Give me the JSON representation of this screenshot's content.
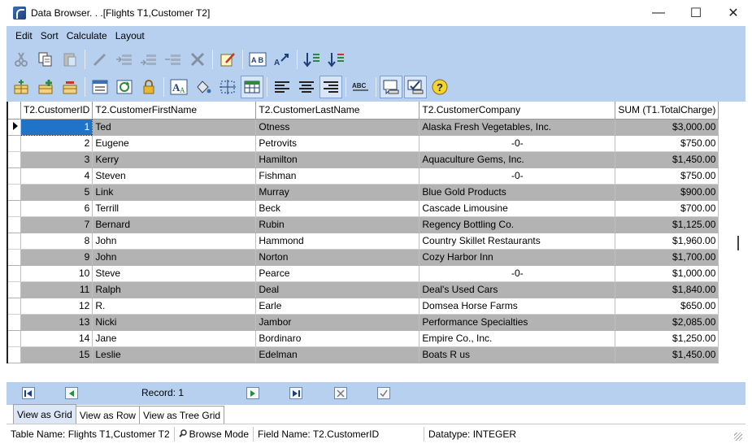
{
  "window": {
    "title": "Data Browser. . .[Flights T1,Customer T2]",
    "minimize_glyph": "—",
    "maximize_glyph": "☐",
    "close_glyph": "✕"
  },
  "menu": [
    "Edit",
    "Sort",
    "Calculate",
    "Layout"
  ],
  "toolbar_row1_icons": [
    "cut-icon",
    "copy-icon",
    "paste-icon",
    "pencil-icon",
    "insert-row-icon",
    "append-row-icon",
    "delete-row-icon",
    "delete-icon",
    "edit-note-icon",
    "find-icon",
    "find-next-icon",
    "sort-ascending-icon",
    "sort-descending-icon"
  ],
  "toolbar_row2_icons": [
    "add-table-icon",
    "add-column-icon",
    "remove-column-icon",
    "form-icon",
    "refresh-icon",
    "lock-icon",
    "font-icon",
    "fill-color-icon",
    "select-grid-icon",
    "grid-lines-icon",
    "align-left-icon",
    "align-center-icon",
    "align-right-icon",
    "spell-check-icon",
    "view-toggle-icon",
    "view-toggle-checked-icon",
    "help-icon"
  ],
  "grid": {
    "columns": [
      "T2.CustomerID",
      "T2.CustomerFirstName",
      "T2.CustomerLastName",
      "T2.CustomerCompany",
      "SUM (T1.TotalCharge)"
    ],
    "rows": [
      [
        "1",
        "Ted",
        "Otness",
        "Alaska Fresh Vegetables, Inc.",
        "$3,000.00"
      ],
      [
        "2",
        "Eugene",
        "Petrovits",
        "-0-",
        "$750.00"
      ],
      [
        "3",
        "Kerry",
        "Hamilton",
        "Aquaculture Gems, Inc.",
        "$1,450.00"
      ],
      [
        "4",
        "Steven",
        "Fishman",
        "-0-",
        "$750.00"
      ],
      [
        "5",
        "Link",
        "Murray",
        "Blue Gold Products",
        "$900.00"
      ],
      [
        "6",
        "Terrill",
        "Beck",
        "Cascade Limousine",
        "$700.00"
      ],
      [
        "7",
        "Bernard",
        "Rubin",
        "Regency Bottling Co.",
        "$1,125.00"
      ],
      [
        "8",
        "John",
        "Hammond",
        "Country Skillet Restaurants",
        "$1,960.00"
      ],
      [
        "9",
        "John",
        "Norton",
        "Cozy Harbor Inn",
        "$1,700.00"
      ],
      [
        "10",
        "Steve",
        "Pearce",
        "-0-",
        "$1,000.00"
      ],
      [
        "11",
        "Ralph",
        "Deal",
        "Deal's Used Cars",
        "$1,840.00"
      ],
      [
        "12",
        "R.",
        "Earle",
        "Domsea Horse Farms",
        "$650.00"
      ],
      [
        "13",
        "Nicki",
        "Jambor",
        "Performance Specialties",
        "$2,085.00"
      ],
      [
        "14",
        "Jane",
        "Bordinaro",
        "Empire Co., Inc.",
        "$1,250.00"
      ],
      [
        "15",
        "Leslie",
        "Edelman",
        "Boats R us",
        "$1,450.00"
      ]
    ]
  },
  "navigator": {
    "record_label": "Record: 1"
  },
  "tabs": [
    "View as Grid",
    "View as Row",
    "View as Tree Grid"
  ],
  "status": {
    "table_name": "Table Name: Flights T1,Customer T2",
    "mode": "Browse Mode",
    "field_name": "Field Name: T2.CustomerID",
    "datatype": "Datatype: INTEGER"
  },
  "colors": {
    "band": "#b8d0ef",
    "row_alt": "#b3b3b3",
    "selection": "#1f73c9"
  }
}
